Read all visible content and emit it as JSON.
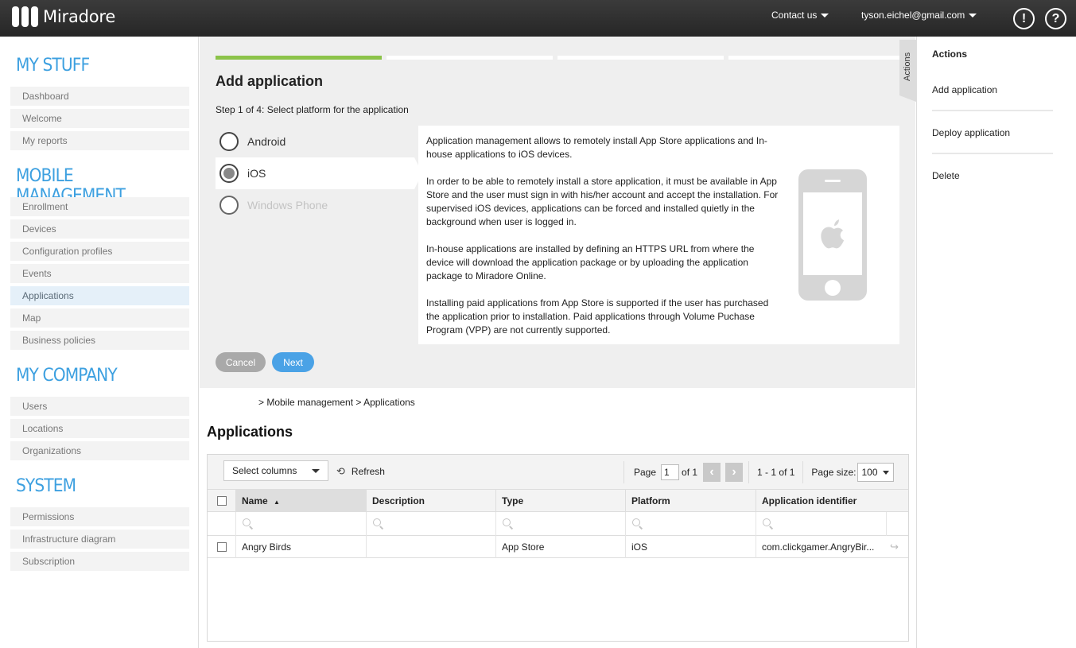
{
  "topbar": {
    "brand": "Miradore",
    "contact": "Contact us",
    "user": "tyson.eichel@gmail.com",
    "alert_icon": "!",
    "help_icon": "?"
  },
  "sidebar": {
    "sections": [
      {
        "title": "MY STUFF",
        "items": [
          "Dashboard",
          "Welcome",
          "My reports"
        ]
      },
      {
        "title": "MOBILE MANAGEMENT",
        "items": [
          "Enrollment",
          "Devices",
          "Configuration profiles",
          "Events",
          "Applications",
          "Map",
          "Business policies"
        ]
      },
      {
        "title": "MY COMPANY",
        "items": [
          "Users",
          "Locations",
          "Organizations"
        ]
      },
      {
        "title": "SYSTEM",
        "items": [
          "Permissions",
          "Infrastructure diagram",
          "Subscription"
        ]
      }
    ],
    "active": "Applications"
  },
  "wizard": {
    "progress_done": 1,
    "progress_total": 4,
    "title": "Add application",
    "step": "Step 1 of 4: Select platform for the application",
    "platforms": [
      {
        "label": "Android",
        "state": "unselected"
      },
      {
        "label": "iOS",
        "state": "selected"
      },
      {
        "label": "Windows Phone",
        "state": "disabled"
      }
    ],
    "info": [
      "Application management allows to remotely install App Store applications and In-house applications to iOS devices.",
      "In order to be able to remotely install a store application, it must be available in App Store and the user must sign in with his/her account and accept the installation. For supervised iOS devices, applications can be forced and installed quietly in the background when user is logged in.",
      "In-house applications are installed by defining an HTTPS URL from where the device will download the application package or by uploading the application package to Miradore Online.",
      "Installing paid applications from App Store is supported if the user has purchased the application prior to installation. Paid applications through Volume Puchase Program (VPP) are not currently supported."
    ],
    "cancel": "Cancel",
    "next": "Next",
    "actions_tab": "Actions"
  },
  "actions": {
    "title": "Actions",
    "items": [
      "Add application",
      "Deploy application",
      "Delete"
    ]
  },
  "breadcrumb": "> Mobile management > Applications",
  "page_title": "Applications",
  "grid": {
    "select_columns": "Select columns",
    "refresh": "Refresh",
    "page_label": "Page",
    "page_value": "1",
    "of_label": "of 1",
    "range": "1 - 1 of 1",
    "page_size_label": "Page size:",
    "page_size": "100",
    "columns": [
      "Name",
      "Description",
      "Type",
      "Platform",
      "Application identifier"
    ],
    "sorted_column": "Name",
    "sort_indicator": "▲",
    "rows": [
      {
        "name": "Angry Birds",
        "description": "",
        "type": "App Store",
        "platform": "iOS",
        "identifier": "com.clickgamer.AngryBir..."
      }
    ]
  },
  "colors": {
    "accent": "#3da0e0",
    "progress": "#8cc34a",
    "next_button": "#4aa2e6",
    "topbar": "#2e2e2e"
  }
}
